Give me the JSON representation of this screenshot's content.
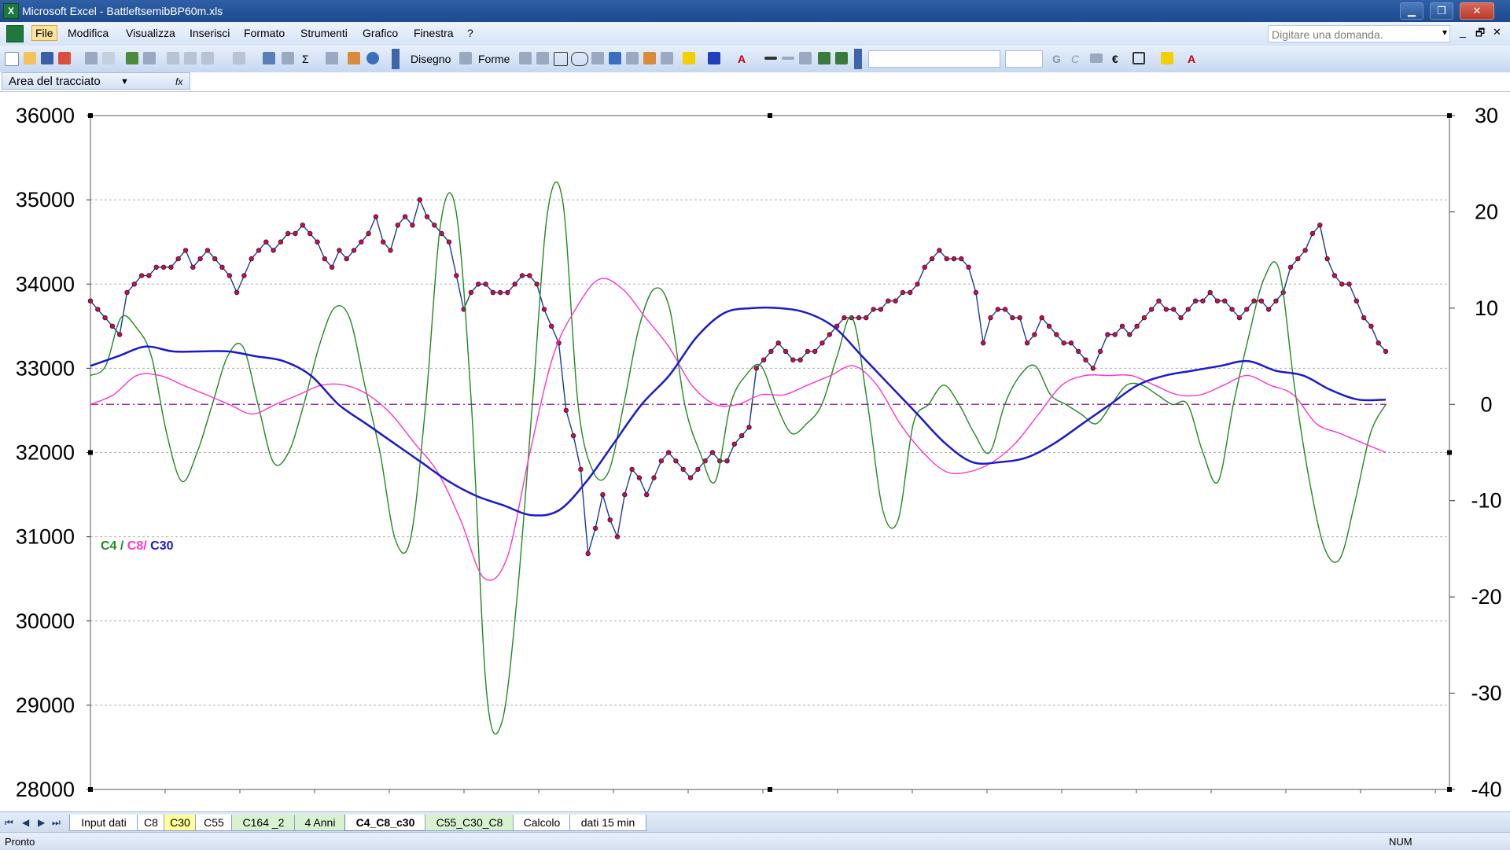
{
  "window": {
    "title": "Microsoft Excel - BattleftsemibBP60m.xls",
    "minimize_symbol": "▁",
    "restore_symbol": "❐",
    "close_symbol": "✕"
  },
  "menu": {
    "items": [
      "File",
      "Modifica",
      "Visualizza",
      "Inserisci",
      "Formato",
      "Strumenti",
      "Grafico",
      "Finestra",
      "?"
    ],
    "ask_placeholder": "Digitare una domanda.",
    "ask_arrow": "▾",
    "doc_minimize": "_",
    "doc_restore": "🗗",
    "doc_close": "✕"
  },
  "toolbar": {
    "disegno_label": "Disegno",
    "forme_label": "Forme",
    "sigma_label": "Σ",
    "bold_label": "G",
    "italic_label": "C",
    "euro_label": "€",
    "font_color_label": "A"
  },
  "namebox": {
    "value": "Area del tracciato",
    "fx_label": "fx"
  },
  "chart_data": {
    "type": "line",
    "y_left": {
      "min": 28000,
      "max": 36000,
      "ticks": [
        "36000",
        "35000",
        "34000",
        "33000",
        "32000",
        "31000",
        "30000",
        "29000",
        "28000"
      ]
    },
    "y_right": {
      "min": -40,
      "max": 30,
      "ticks": [
        "30",
        "20",
        "10",
        "0",
        "-10",
        "-20",
        "-30",
        "-40"
      ]
    },
    "legend_parts": [
      {
        "text": "C4",
        "color": "#1f8a1f"
      },
      {
        "text": " / ",
        "color": "#1f8a1f"
      },
      {
        "text": "C8/",
        "color": "#ff33cc"
      },
      {
        "text": " ",
        "color": "#ff33cc"
      },
      {
        "text": "C30",
        "color": "#1a1acc"
      }
    ],
    "zero_line": 0,
    "series": [
      {
        "axis": "left",
        "color": "#1a3a9c",
        "marker_color": "#c0124a",
        "values": [
          33800,
          33700,
          33600,
          33500,
          33400,
          33900,
          34000,
          34100,
          34100,
          34200,
          34200,
          34200,
          34300,
          34400,
          34200,
          34300,
          34400,
          34300,
          34200,
          34100,
          33900,
          34100,
          34300,
          34400,
          34500,
          34400,
          34500,
          34600,
          34600,
          34700,
          34600,
          34500,
          34300,
          34200,
          34400,
          34300,
          34400,
          34500,
          34600,
          34800,
          34500,
          34400,
          34700,
          34800,
          34700,
          35000,
          34800,
          34700,
          34600,
          34500,
          34100,
          33700,
          33900,
          34000,
          34000,
          33900,
          33900,
          33900,
          34000,
          34100,
          34100,
          34000,
          33700,
          33500,
          33300,
          32500,
          32200,
          31800,
          30800,
          31100,
          31500,
          31200,
          31000,
          31500,
          31800,
          31700,
          31500,
          31700,
          31900,
          32000,
          31900,
          31800,
          31700,
          31800,
          31900,
          32000,
          31900,
          31900,
          32100,
          32200,
          32300,
          33000,
          33100,
          33200,
          33300,
          33200,
          33100,
          33100,
          33200,
          33200,
          33300,
          33400,
          33500,
          33600,
          33600,
          33600,
          33600,
          33700,
          33700,
          33800,
          33800,
          33900,
          33900,
          34000,
          34200,
          34300,
          34400,
          34300,
          34300,
          34300,
          34200,
          33900,
          33300,
          33600,
          33700,
          33700,
          33600,
          33600,
          33300,
          33400,
          33600,
          33500,
          33400,
          33300,
          33300,
          33200,
          33100,
          33000,
          33200,
          33400,
          33400,
          33500,
          33400,
          33500,
          33600,
          33700,
          33800,
          33700,
          33700,
          33600,
          33700,
          33800,
          33800,
          33900,
          33800,
          33800,
          33700,
          33600,
          33700,
          33800,
          33800,
          33700,
          33800,
          33900,
          34200,
          34300,
          34400,
          34600,
          34700,
          34300,
          34100,
          34000,
          34000,
          33800,
          33600,
          33500,
          33300,
          33200
        ]
      },
      {
        "axis": "right",
        "color": "#1f8a1f",
        "values": [
          3,
          4,
          9,
          8,
          5,
          -3,
          -8,
          -5,
          0,
          5,
          6,
          0,
          -6,
          -5,
          0,
          6,
          10,
          9,
          2,
          -5,
          -14,
          -14,
          0,
          19,
          20,
          0,
          -30,
          -33,
          -20,
          0,
          20,
          21,
          0,
          -7,
          -7,
          0,
          8,
          12,
          10,
          0,
          -5,
          -8,
          0,
          3,
          4,
          0,
          -3,
          -2,
          0,
          5,
          9,
          0,
          -11,
          -12,
          -2,
          0,
          2,
          0,
          -3,
          -5,
          0,
          3,
          4,
          1,
          0,
          -1,
          -2,
          0,
          2,
          2,
          1,
          0,
          0,
          -5,
          -8,
          0,
          7,
          13,
          14,
          2,
          -8,
          -15,
          -16,
          -10,
          -3,
          0
        ]
      },
      {
        "axis": "right",
        "color": "#ff33cc",
        "values": [
          0,
          1,
          3,
          3,
          2,
          1,
          0,
          -1,
          0,
          1,
          2,
          2,
          1,
          -1,
          -4,
          -7,
          -12,
          -18,
          -16,
          -5,
          5,
          10,
          13,
          12,
          9,
          6,
          2,
          0,
          0,
          1,
          1,
          2,
          3,
          4,
          2,
          -2,
          -5,
          -7,
          -7,
          -6,
          -4,
          -1,
          2,
          3,
          3,
          3,
          2,
          1,
          1,
          2,
          3,
          2,
          1,
          -2,
          -3,
          -4,
          -5
        ]
      },
      {
        "axis": "right",
        "color": "#1a1acc",
        "values": [
          4,
          5,
          6,
          5.5,
          5.5,
          5.5,
          5,
          4.5,
          3,
          0,
          -2,
          -4,
          -6,
          -8,
          -9.5,
          -10.5,
          -11.5,
          -11,
          -8,
          -4,
          0,
          3,
          7,
          9.5,
          10,
          10,
          9.5,
          8,
          5,
          2,
          -1,
          -4,
          -6,
          -6,
          -5.5,
          -4,
          -2,
          0,
          2,
          3,
          3.5,
          4,
          4.5,
          3.5,
          3,
          1.5,
          0.5,
          0.5
        ]
      }
    ]
  },
  "sheet_tabs": [
    "Input dati",
    "C8",
    "C30",
    "C55",
    "C164 _2",
    "4 Anni",
    "C4_C8_c30",
    "C55_C30_C8",
    "Calcolo",
    "dati 15 min"
  ],
  "sheet_nav": [
    "⏮",
    "◀",
    "▶",
    "⏭"
  ],
  "status": {
    "text": "Pronto",
    "num": "NUM"
  }
}
